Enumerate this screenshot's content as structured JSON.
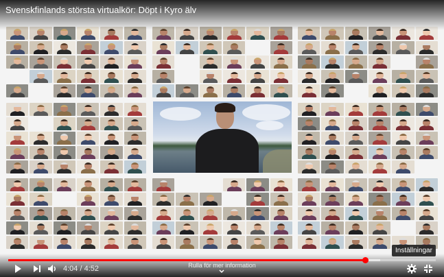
{
  "video": {
    "title": "Svenskfinlands största virtualkör: Döpt i Kyro älv"
  },
  "player": {
    "current_time": "4:04",
    "duration": "4:52",
    "time_display": "4:04 / 4:52",
    "progress_fraction": 0.835,
    "buffered_fraction": 0.87,
    "more_info_label": "Rulla för mer information",
    "settings_tooltip": "Inställningar"
  },
  "icons": {
    "play": "play-icon",
    "next": "next-icon",
    "volume": "volume-icon",
    "settings": "gear-icon",
    "fullscreen": "fullscreen-icon",
    "scroll": "chevron-down-icon"
  },
  "colors": {
    "progress": "#ff0000"
  }
}
